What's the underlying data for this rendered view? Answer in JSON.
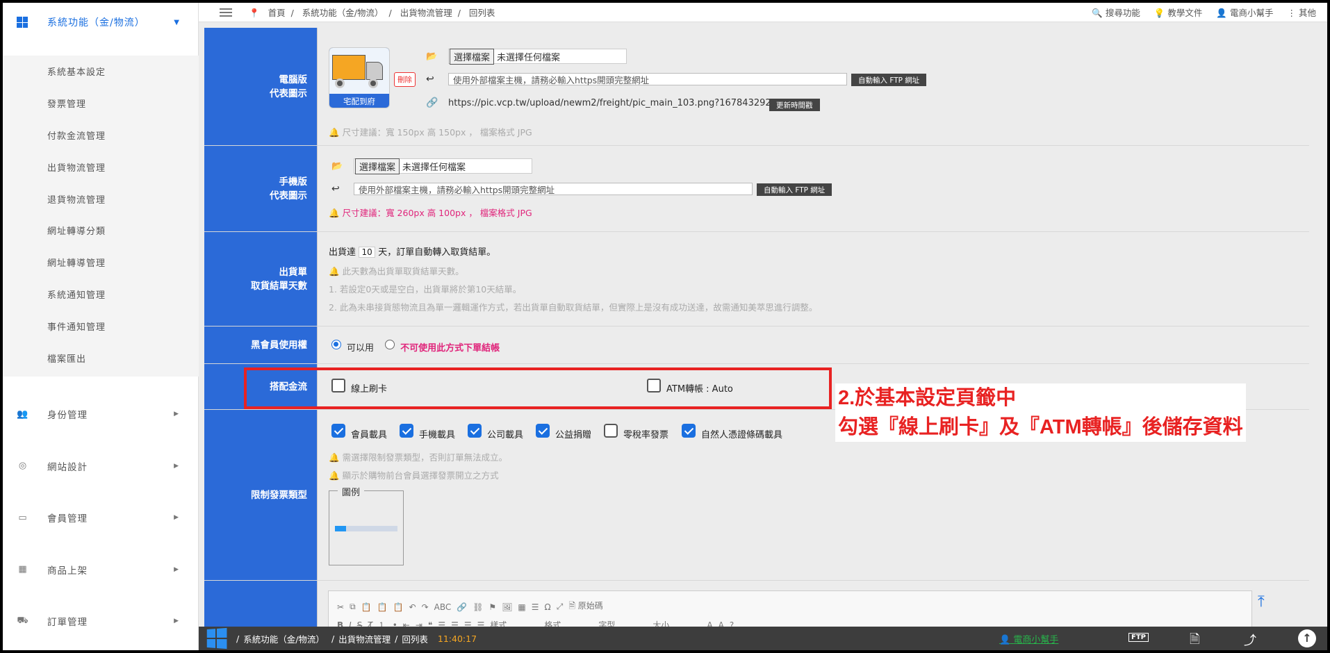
{
  "sidebar": {
    "header": "系統功能（金/物流）",
    "sub_items": [
      "系統基本設定",
      "發票管理",
      "付款金流管理",
      "出貨物流管理",
      "退貨物流管理",
      "網址轉導分類",
      "網址轉導管理",
      "系統通知管理",
      "事件通知管理",
      "檔案匯出"
    ],
    "main_items": [
      {
        "label": "身份管理",
        "icon": "users-icon"
      },
      {
        "label": "網站設計",
        "icon": "globe-icon"
      },
      {
        "label": "會員管理",
        "icon": "id-card-icon"
      },
      {
        "label": "商品上架",
        "icon": "boxes-icon"
      },
      {
        "label": "訂單管理",
        "icon": "truck-icon"
      }
    ]
  },
  "topbar": {
    "breadcrumbs": [
      "首頁",
      "系統功能（金/物流）",
      "出貨物流管理",
      "回列表"
    ],
    "search": "搜尋功能",
    "docs": "教學文件",
    "helper": "電商小幫手",
    "other": "其他"
  },
  "desktop_image": {
    "label": "電腦版\n代表圖示",
    "choose_button": "選擇檔案",
    "no_file": "未選擇任何檔案",
    "external_placeholder": "使用外部檔案主機，請務必輸入https開頭完整網址",
    "ftp_button": "自動輸入 FTP 網址",
    "url": "https://pic.vcp.tw/upload/newm2/freight/pic_main_103.png?1678432922",
    "refresh_button": "更新時間戳",
    "hint": "尺寸建議：寬 150px 高 150px ， 檔案格式 JPG",
    "thumb_caption": "宅配到府",
    "delete_button": "刪除"
  },
  "mobile_image": {
    "label": "手機版\n代表圖示",
    "choose_button": "選擇檔案",
    "no_file": "未選擇任何檔案",
    "external_placeholder": "使用外部檔案主機，請務必輸入https開頭完整網址",
    "ftp_button": "自動輸入 FTP 網址",
    "hint": "尺寸建議：寬 260px 高 100px ， 檔案格式 JPG"
  },
  "pickup_days": {
    "label": "出貨單\n取貨結單天數",
    "prefix": "出貨達",
    "value": "10",
    "suffix": "天，訂單自動轉入取貨結單。",
    "hint": "此天數為出貨單取貨結單天數。",
    "note1": "1. 若設定0天或是空白，出貨單將於第10天結單。",
    "note2": "2. 此為未串接貨態物流且為單一邏輯運作方式，若出貨單自動取貨結單，但實際上是沒有成功送達，故需通知美萃思進行調整。"
  },
  "blacklist": {
    "label": "黑會員使用權",
    "opt_yes": "可以用",
    "opt_no": "不可使用此方式下單結帳"
  },
  "payment": {
    "label": "搭配金流",
    "opt1": "線上刷卡",
    "opt2": "ATM轉帳 : Auto"
  },
  "invoice": {
    "label": "限制發票類型",
    "options": [
      {
        "label": "會員載具",
        "checked": true
      },
      {
        "label": "手機載具",
        "checked": true
      },
      {
        "label": "公司載具",
        "checked": true
      },
      {
        "label": "公益捐贈",
        "checked": true
      },
      {
        "label": "零稅率發票",
        "checked": false
      },
      {
        "label": "自然人憑證條碼載具",
        "checked": true
      }
    ],
    "hint1": "需選擇限制發票類型，否則訂單無法成立。",
    "hint2": "顯示於購物前台會員選擇發票開立之方式",
    "legend": "圖例"
  },
  "editor": {
    "source_button": "原始碼",
    "style": "樣式",
    "format": "格式",
    "font": "字型",
    "size": "大小"
  },
  "callout": {
    "line1": "2.於基本設定頁籤中",
    "line2": "勾選『線上刷卡』及『ATM轉帳』後儲存資料"
  },
  "bottombar": {
    "path": [
      "系統功能（金/物流）",
      "出貨物流管理",
      "回列表"
    ],
    "time": "11:40:17",
    "helper": "電商小幫手",
    "ftp": "FTP"
  },
  "colors": {
    "label_blue": "#2b6ad8",
    "accent": "#1a6fe0",
    "highlight_red": "#e82222",
    "hint_pink": "#e0257b"
  }
}
